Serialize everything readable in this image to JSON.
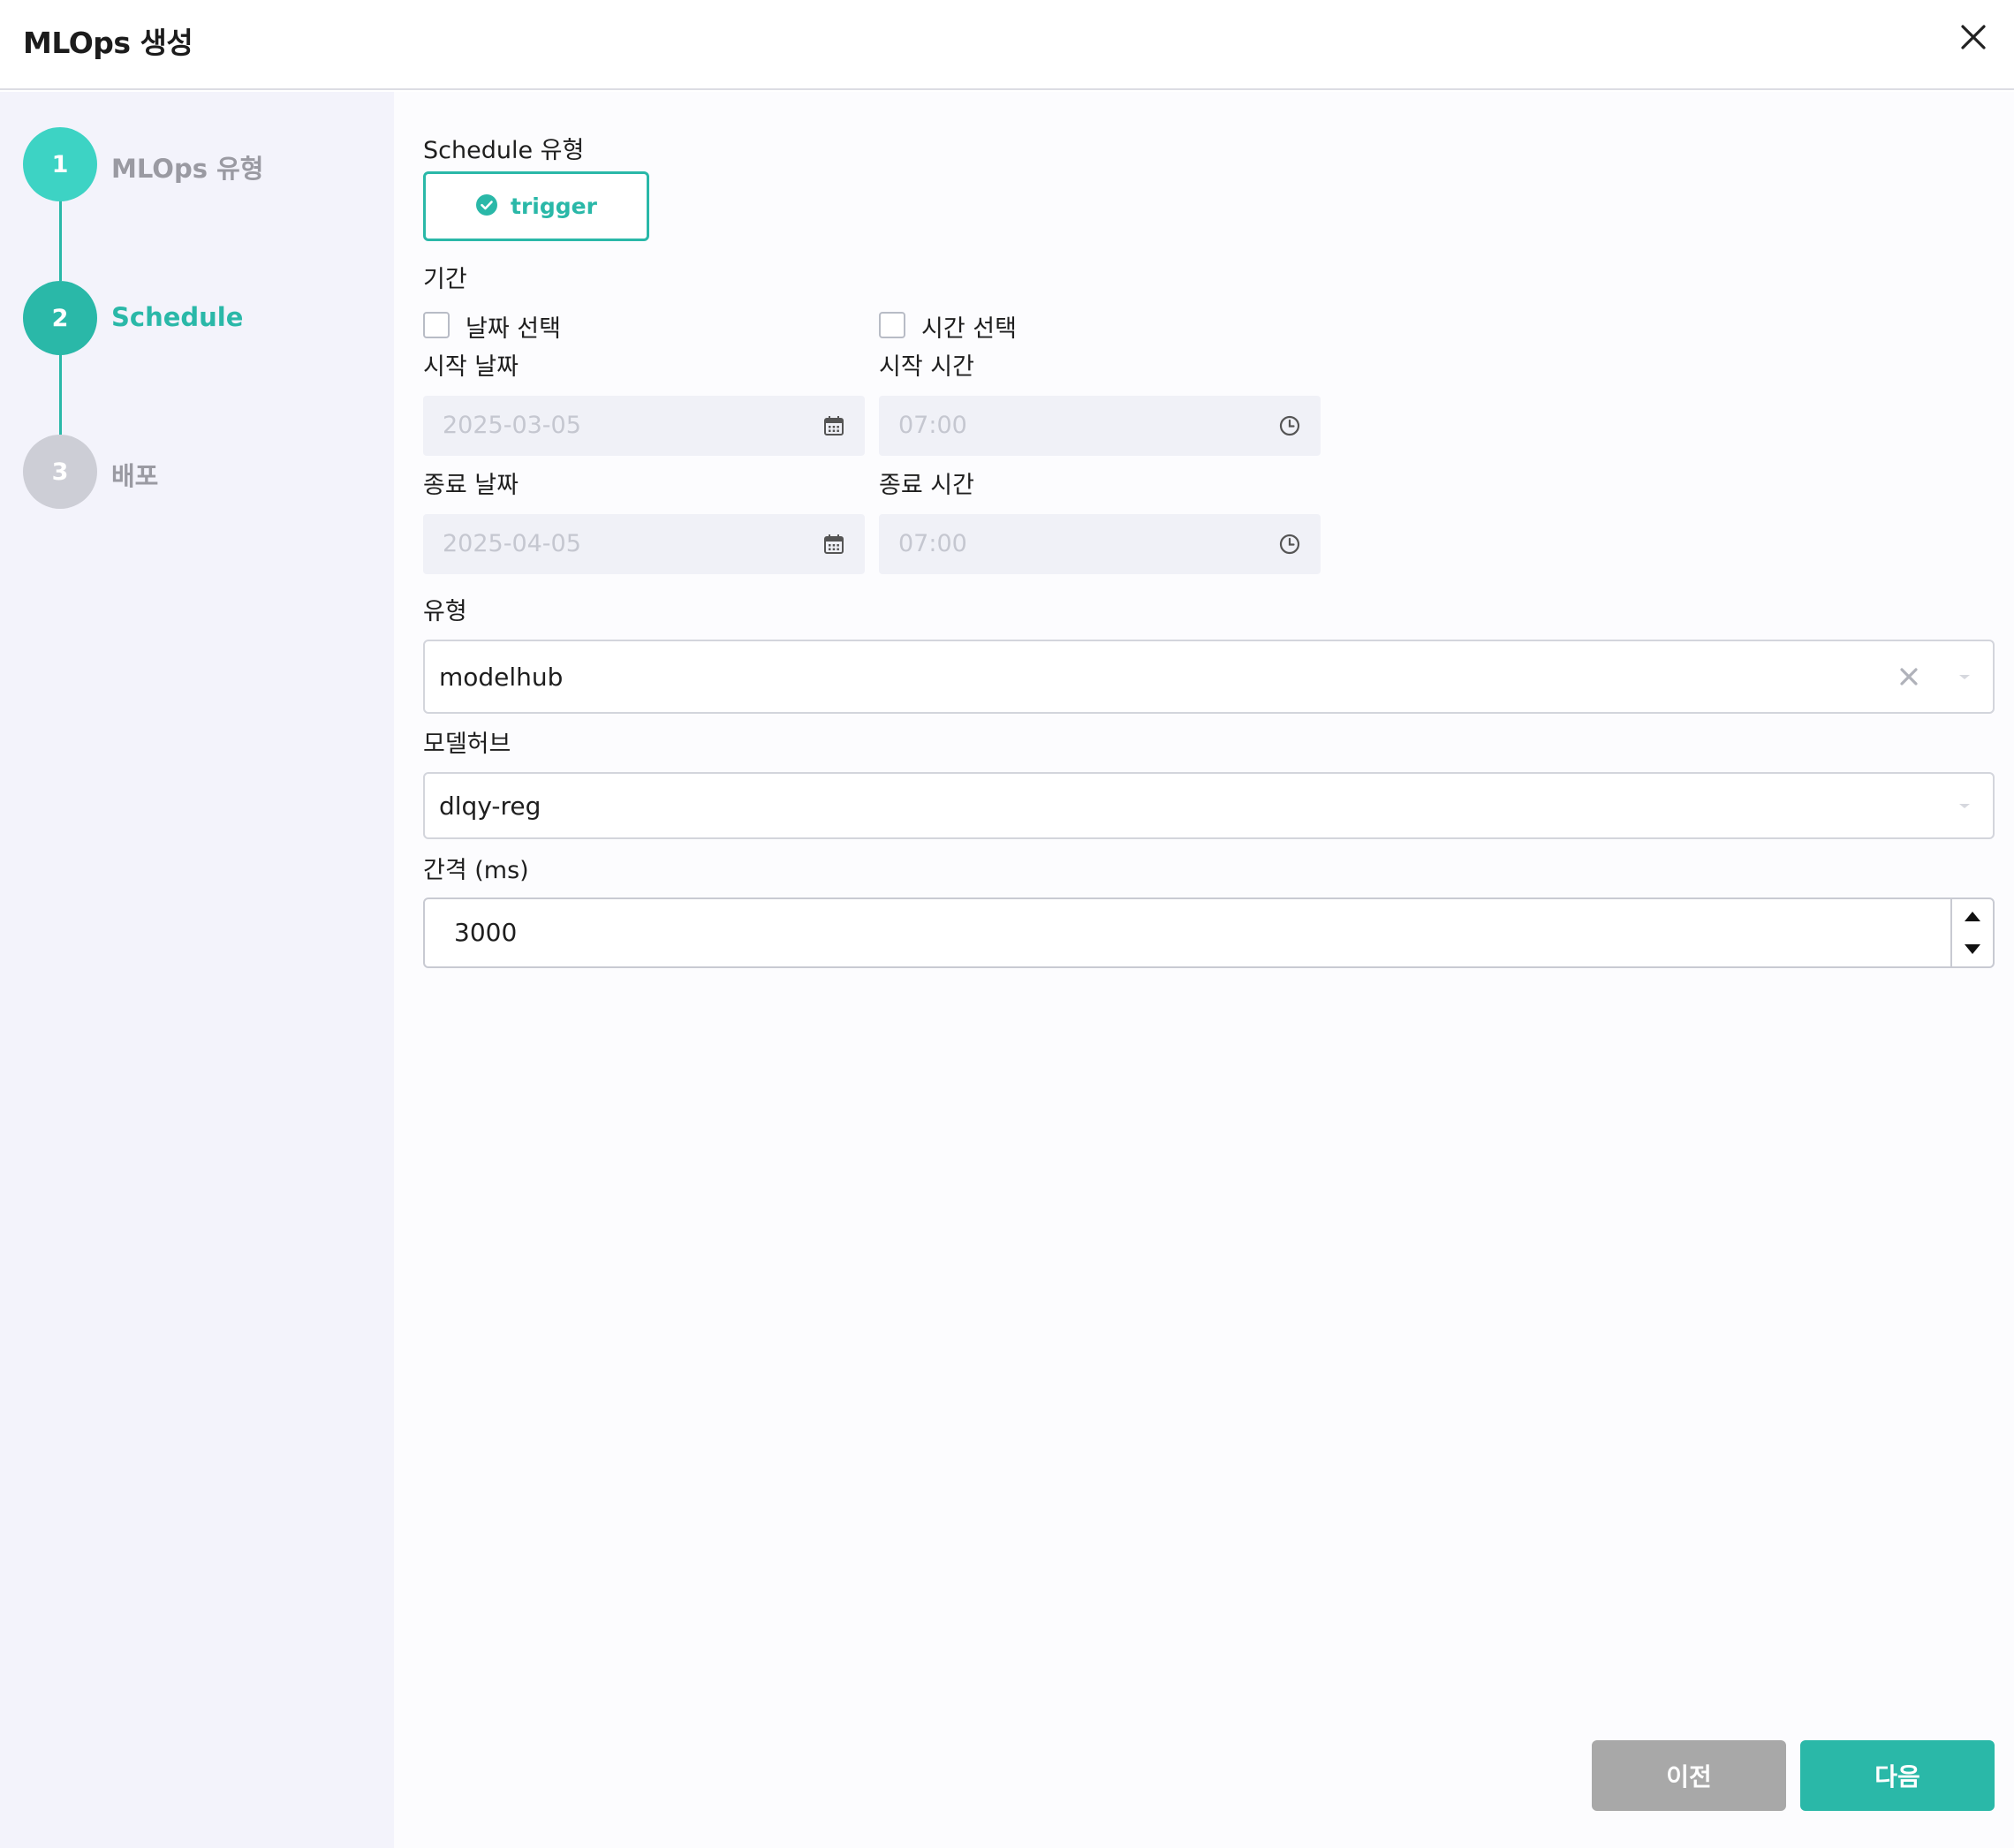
{
  "header": {
    "title": "MLOps 생성",
    "close_icon": "close-icon"
  },
  "steps": [
    {
      "number": "1",
      "label": "MLOps 유형",
      "state": "completed"
    },
    {
      "number": "2",
      "label": "Schedule",
      "state": "active"
    },
    {
      "number": "3",
      "label": "배포",
      "state": "pending"
    }
  ],
  "form": {
    "schedule_type_label": "Schedule 유형",
    "schedule_type_option": "trigger",
    "period_label": "기간",
    "date_select_label": "날짜 선택",
    "time_select_label": "시간 선택",
    "date_select_checked": false,
    "time_select_checked": false,
    "start_date_label": "시작 날짜",
    "start_date_value": "2025-03-05",
    "start_time_label": "시작 시간",
    "start_time_value": "07:00",
    "end_date_label": "종료 날짜",
    "end_date_value": "2025-04-05",
    "end_time_label": "종료 시간",
    "end_time_value": "07:00",
    "type_label": "유형",
    "type_value": "modelhub",
    "modelhub_label": "모델허브",
    "modelhub_value": "dlqy-reg",
    "interval_label": "간격 (ms)",
    "interval_value": "3000"
  },
  "footer": {
    "prev_label": "이전",
    "next_label": "다음"
  },
  "colors": {
    "accent": "#2ab8a8",
    "step1": "#3dd3c4",
    "step2": "#2ab8a8",
    "step3": "#cdced6",
    "prev_button": "#a8a8a8",
    "sidebar_bg": "#f3f3fb"
  }
}
